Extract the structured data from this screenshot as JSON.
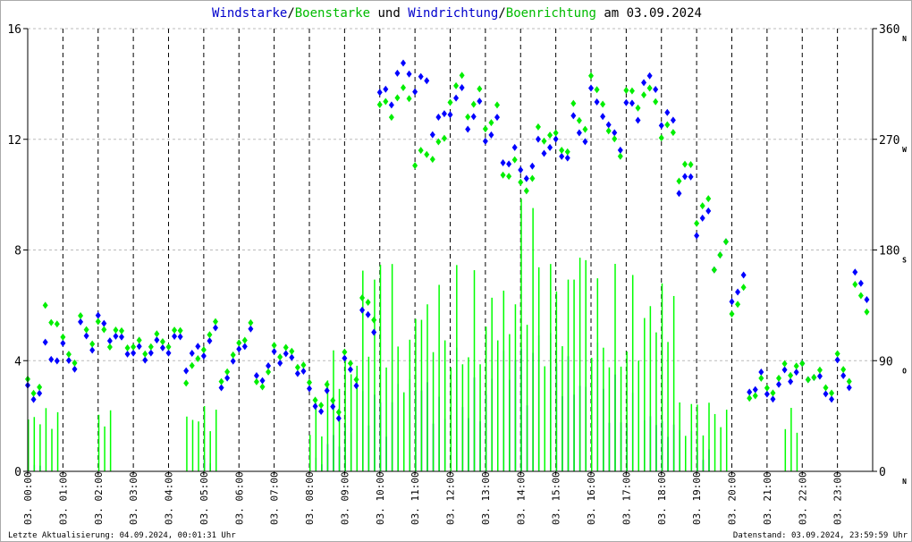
{
  "chart_data": {
    "type": "scatter",
    "title_parts": [
      {
        "text": "Windstarke",
        "color": "#0000cc"
      },
      {
        "text": "/",
        "color": "#000000"
      },
      {
        "text": "Boenstarke",
        "color": "#00bb00"
      },
      {
        "text": " und ",
        "color": "#000000"
      },
      {
        "text": "Windrichtung",
        "color": "#0000cc"
      },
      {
        "text": "/",
        "color": "#000000"
      },
      {
        "text": "Boenrichtung",
        "color": "#00bb00"
      },
      {
        "text": " am 03.09.2024",
        "color": "#000000"
      }
    ],
    "y_left": {
      "range": [
        0,
        16
      ],
      "ticks": [
        "0",
        "4",
        "8",
        "12",
        "16"
      ]
    },
    "y_right": {
      "range": [
        0,
        360
      ],
      "ticks": [
        "0",
        "90",
        "180",
        "270",
        "360"
      ],
      "compass": [
        "N",
        "O",
        "S",
        "W",
        "N"
      ]
    },
    "x_ticks": [
      "03. 00:00",
      "03. 01:00",
      "03. 02:00",
      "03. 03:00",
      "03. 04:00",
      "03. 05:00",
      "03. 06:00",
      "03. 07:00",
      "03. 08:00",
      "03. 09:00",
      "03. 10:00",
      "03. 11:00",
      "03. 12:00",
      "03. 13:00",
      "03. 14:00",
      "03. 15:00",
      "03. 16:00",
      "03. 17:00",
      "03. 18:00",
      "03. 19:00",
      "03. 20:00",
      "03. 21:00",
      "03. 22:00",
      "03. 23:00"
    ],
    "x_hours": [
      0,
      0.5,
      1,
      1.5,
      2,
      2.5,
      3,
      3.5,
      4,
      4.5,
      5,
      5.5,
      6,
      6.5,
      7,
      7.5,
      8,
      8.5,
      9,
      9.5,
      10,
      10.5,
      11,
      11.5,
      12,
      12.5,
      13,
      13.5,
      14,
      14.5,
      15,
      15.5,
      16,
      16.5,
      17,
      17.5,
      18,
      18.5,
      19,
      19.5,
      20,
      20.5,
      21,
      21.5,
      22,
      22.5,
      23,
      23.5
    ],
    "series": [
      {
        "name": "Windstarke",
        "color": "#0000ff",
        "kind": "bar",
        "values": [
          0.3,
          0,
          0,
          0,
          0,
          0,
          0,
          0,
          0,
          0,
          0.5,
          0,
          0,
          0,
          0,
          0,
          0.5,
          1.5,
          2,
          3,
          2.5,
          3.5,
          4,
          3,
          4.5,
          3.5,
          4,
          5,
          4.5,
          5,
          4.5,
          4,
          5,
          3.5,
          3,
          2.5,
          2,
          1.5,
          0.8,
          0,
          0,
          0,
          0,
          0,
          0,
          0,
          0,
          0
        ]
      },
      {
        "name": "Boenstarke",
        "color": "#00ff00",
        "kind": "bar",
        "values": [
          2.5,
          2.5,
          0,
          0,
          2.5,
          0,
          0,
          0,
          0,
          2.5,
          2.5,
          0,
          0,
          0,
          0,
          0,
          2.5,
          5,
          5,
          7.5,
          7.5,
          5,
          7.5,
          7.5,
          7.5,
          7.5,
          7.5,
          7.5,
          10,
          7.5,
          7.5,
          10,
          7.5,
          7.5,
          7.5,
          7.5,
          7.5,
          2.5,
          2.5,
          2.5,
          0,
          0,
          0,
          2.5,
          0,
          0,
          0,
          0
        ]
      },
      {
        "name": "Windrichtung",
        "color": "#0000ff",
        "kind": "diamond",
        "values": [
          70,
          100,
          95,
          110,
          115,
          100,
          90,
          95,
          100,
          90,
          105,
          80,
          110,
          85,
          100,
          90,
          60,
          55,
          80,
          120,
          300,
          320,
          310,
          280,
          300,
          290,
          280,
          260,
          250,
          270,
          265,
          280,
          300,
          270,
          290,
          310,
          280,
          230,
          200,
          175,
          150,
          75,
          70,
          85,
          85,
          70,
          80,
          150
        ]
      },
      {
        "name": "Boenrichtung",
        "color": "#00ee00",
        "kind": "diamond",
        "values": [
          75,
          130,
          100,
          115,
          110,
          105,
          95,
          100,
          105,
          80,
          110,
          85,
          115,
          80,
          105,
          95,
          65,
          60,
          85,
          130,
          290,
          300,
          250,
          260,
          310,
          300,
          290,
          250,
          240,
          280,
          270,
          290,
          310,
          265,
          300,
          300,
          270,
          240,
          210,
          175,
          140,
          70,
          75,
          90,
          85,
          75,
          85,
          140
        ]
      }
    ]
  },
  "footer": {
    "left": "Letzte Aktualisierung: 04.09.2024, 00:01:31 Uhr",
    "right": "Datenstand: 03.09.2024, 23:59:59 Uhr"
  }
}
